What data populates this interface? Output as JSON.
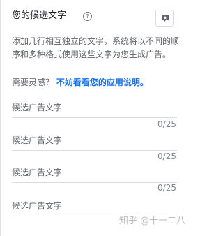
{
  "header": {
    "title": "您的候选文字",
    "help_icon_glyph": "?"
  },
  "description": "添加几行相互独立的文字，系统将以不同的顺序和多种格式使用这些文字为您生成广告。",
  "inspiration": {
    "prompt": "需要灵感？",
    "link": "不妨看看您的应用说明。"
  },
  "fields": [
    {
      "placeholder": "候选广告文字",
      "value": "",
      "counter": "0/25"
    },
    {
      "placeholder": "候选广告文字",
      "value": "",
      "counter": "0/25"
    },
    {
      "placeholder": "候选广告文字",
      "value": "",
      "counter": "0/25"
    },
    {
      "placeholder": "候选广告文字",
      "value": "",
      "counter": "0/25"
    }
  ],
  "watermark": "知乎 @十一二八",
  "icons": {
    "tip_button": "lightbulb-comment-icon",
    "help": "help-circle-icon"
  },
  "colors": {
    "link": "#1a73e8",
    "text_secondary": "#5f6368",
    "divider": "#dadce0"
  }
}
